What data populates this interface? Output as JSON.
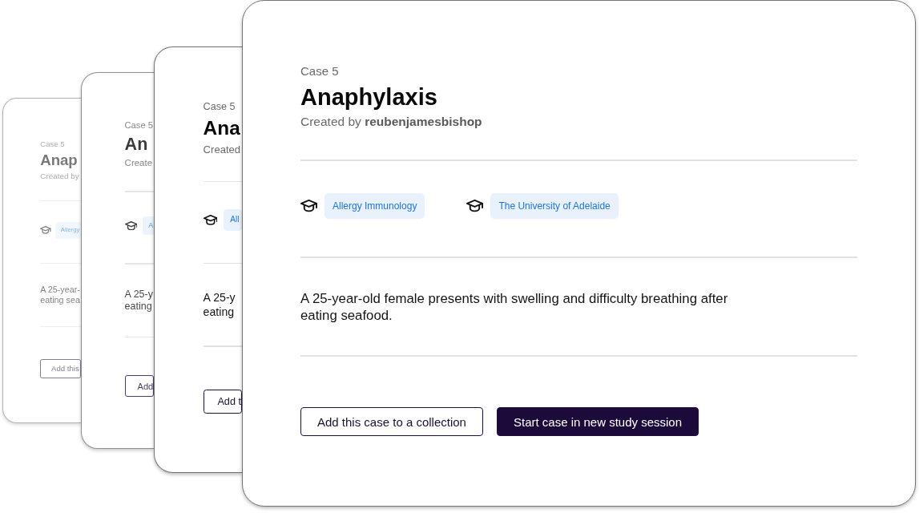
{
  "cards": [
    {
      "case_label": "Case 5",
      "title": "Anap",
      "author": "Created by",
      "tags": [
        {
          "label": "Allergy"
        }
      ],
      "description_lines": [
        "A 25-year-",
        "eating sea"
      ],
      "buttons": [
        {
          "label": "Add this",
          "kind": "outline"
        }
      ]
    },
    {
      "case_label": "Case 5",
      "title": "An",
      "author": "Create",
      "tags": [
        {
          "label": "A"
        }
      ],
      "description_lines": [
        "A 25-y",
        "eating"
      ],
      "buttons": [
        {
          "label": "Add",
          "kind": "outline"
        }
      ]
    },
    {
      "case_label": "Case 5",
      "title": "Ana",
      "author": "Created",
      "tags": [
        {
          "label": "All"
        }
      ],
      "description_lines": [
        "A 25-y",
        "eating"
      ],
      "buttons": [
        {
          "label": "Add t",
          "kind": "outline"
        }
      ]
    },
    {
      "case_label": "Case 5",
      "title": "Anaphylaxis",
      "author": "Created by **reubenjamesbishop**",
      "tags": [
        {
          "label": "Allergy Immunology"
        },
        {
          "label": "The University of Adelaide"
        }
      ],
      "description_lines": [
        "A 25-year-old female presents with swelling and difficulty breathing after",
        "eating seafood."
      ],
      "buttons": [
        {
          "label": "Add this case to a collection",
          "kind": "outline"
        },
        {
          "label": "Start case in new study session",
          "kind": "primary"
        }
      ]
    }
  ]
}
